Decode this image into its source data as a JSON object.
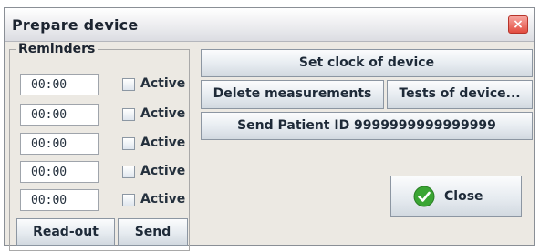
{
  "window": {
    "title": "Prepare device",
    "close_glyph": "×"
  },
  "reminders": {
    "legend": "Reminders",
    "rows": [
      {
        "time": "00:00",
        "checkbox_label": "Active"
      },
      {
        "time": "00:00",
        "checkbox_label": "Active"
      },
      {
        "time": "00:00",
        "checkbox_label": "Active"
      },
      {
        "time": "00:00",
        "checkbox_label": "Active"
      },
      {
        "time": "00:00",
        "checkbox_label": "Active"
      }
    ],
    "readout_label": "Read-out",
    "send_label": "Send"
  },
  "actions": {
    "set_clock_label": "Set clock of device",
    "delete_label": "Delete measurements",
    "tests_label": "Tests of device...",
    "send_patient_label": "Send Patient ID 9999999999999999",
    "close_label": "Close"
  },
  "icons": {
    "close_icon": "check-circle-icon",
    "window_close": "close-icon"
  },
  "colors": {
    "close_icon_green": "#3aa533",
    "window_close_red": "#e24c3f"
  }
}
